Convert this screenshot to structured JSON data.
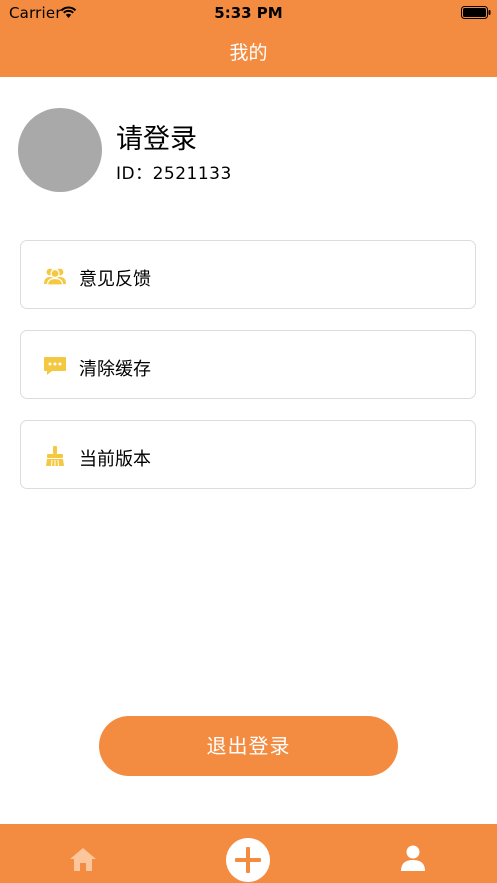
{
  "status_bar": {
    "carrier": "Carrier",
    "time": "5:33 PM",
    "wifi_icon": "wifi-icon",
    "battery_icon": "battery-icon"
  },
  "nav": {
    "title": "我的"
  },
  "profile": {
    "name": "请登录",
    "id_text": "ID：2521133",
    "avatar_color": "#A9A9A9"
  },
  "menu": [
    {
      "label": "意见反馈",
      "icon": "users-icon",
      "icon_color": "#F5C842"
    },
    {
      "label": "清除缓存",
      "icon": "chat-icon",
      "icon_color": "#F5C842"
    },
    {
      "label": "当前版本",
      "icon": "broom-icon",
      "icon_color": "#F5C842"
    }
  ],
  "logout_label": "退出登录",
  "tabbar": {
    "items": [
      {
        "name": "home",
        "icon": "home-icon"
      },
      {
        "name": "add",
        "icon": "plus-circle-icon"
      },
      {
        "name": "profile",
        "icon": "person-icon"
      }
    ]
  },
  "colors": {
    "accent": "#F38B40",
    "card_border": "#DCDCDC",
    "icon_yellow": "#F5C842",
    "tab_inactive": "#FBC69C"
  }
}
